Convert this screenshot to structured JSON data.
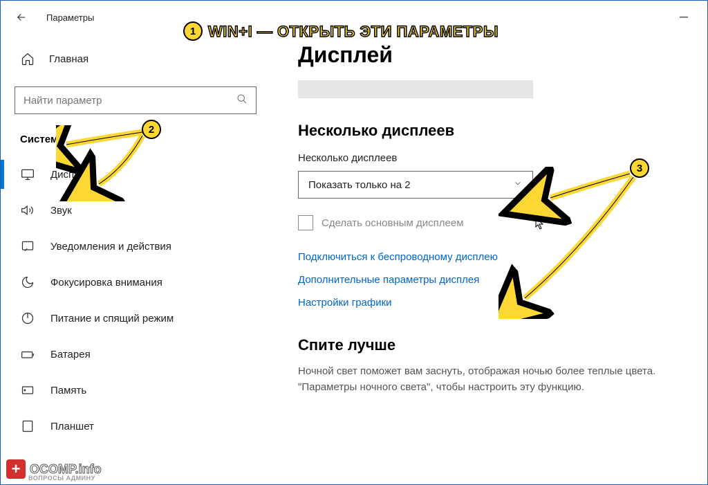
{
  "header": {
    "title": "Параметры"
  },
  "sidebar": {
    "home": "Главная",
    "search_placeholder": "Найти параметр",
    "section": "Система",
    "items": [
      {
        "label": "Дисплей"
      },
      {
        "label": "Звук"
      },
      {
        "label": "Уведомления и действия"
      },
      {
        "label": "Фокусировка внимания"
      },
      {
        "label": "Питание и спящий режим"
      },
      {
        "label": "Батарея"
      },
      {
        "label": "Память"
      },
      {
        "label": "Планшет"
      }
    ]
  },
  "main": {
    "title": "Дисплей",
    "multi_title": "Несколько дисплеев",
    "multi_label": "Несколько дисплеев",
    "select_value": "Показать только на 2",
    "checkbox_label": "Сделать основным дисплеем",
    "links": {
      "wireless": "Подключиться к беспроводному дисплею",
      "advanced": "Дополнительные параметры дисплея",
      "graphics": "Настройки графики"
    },
    "sleep_title": "Спите лучше",
    "sleep_text": "Ночной свет поможет вам заснуть, отображая ночью более теплые цвета. \"Параметры ночного света\", чтобы настроить эту функцию."
  },
  "annotation": {
    "text": "WIN+I  —  ОТКРЫТЬ ЭТИ ПАРАМЕТРЫ",
    "b1": "1",
    "b2": "2",
    "b3": "3"
  },
  "watermark": {
    "brand": "OCOMP.info",
    "sub": "ВОПРОСЫ АДМИНУ"
  }
}
